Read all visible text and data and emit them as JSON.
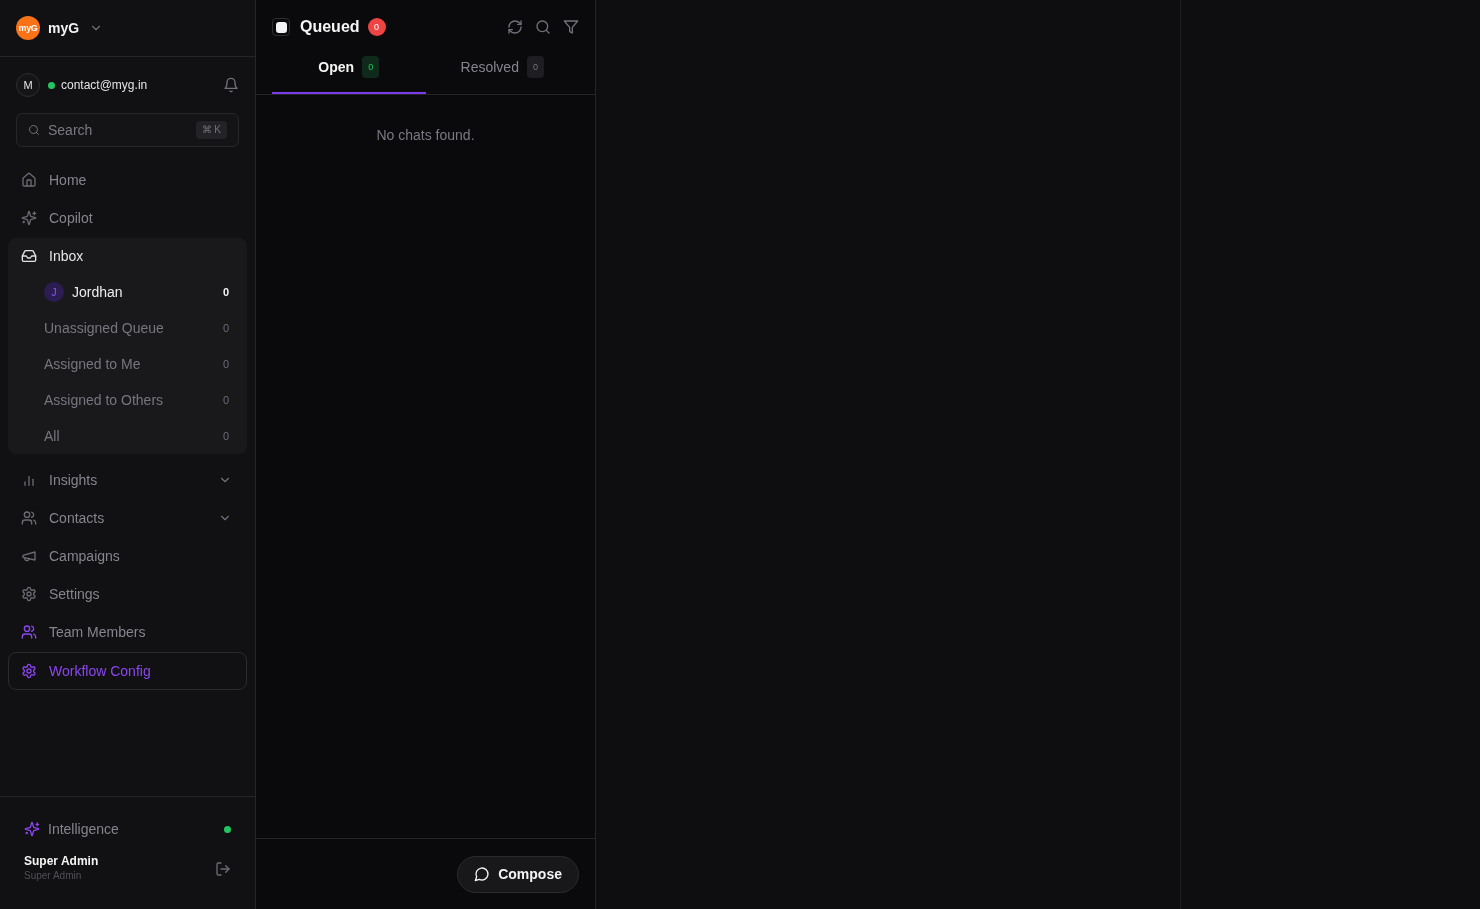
{
  "sidebar": {
    "workspace": {
      "logo": "myG",
      "name": "myG"
    },
    "account": {
      "avatar": "M",
      "email": "contact@myg.in",
      "online": true
    },
    "search": {
      "placeholder": "Search",
      "shortcut": "⌘ K"
    },
    "nav": [
      {
        "label": "Home",
        "kind": "link",
        "selected": false
      },
      {
        "label": "Copilot",
        "kind": "link",
        "selected": false
      },
      {
        "label": "Inbox",
        "kind": "group",
        "selected": false,
        "expanded": true,
        "children": [
          {
            "label": "Jordhan",
            "kind": "agent",
            "avatar": "J",
            "count": "0",
            "selected": true
          },
          {
            "label": "Unassigned Queue",
            "kind": "queue",
            "count": "0",
            "selected": false
          },
          {
            "label": "Assigned to Me",
            "kind": "queue",
            "count": "0",
            "selected": false
          },
          {
            "label": "Assigned to Others",
            "kind": "queue",
            "count": "0",
            "selected": false
          },
          {
            "label": "All",
            "kind": "queue",
            "count": "0",
            "selected": false
          }
        ]
      },
      {
        "label": "Insights",
        "kind": "menu",
        "selected": false,
        "expanded": false
      },
      {
        "label": "Contacts",
        "kind": "menu",
        "selected": false,
        "expanded": false
      },
      {
        "label": "Campaigns",
        "kind": "link",
        "selected": false
      },
      {
        "label": "Settings",
        "kind": "link",
        "selected": false
      },
      {
        "label": "Team Members",
        "kind": "link",
        "selected": false
      },
      {
        "label": "Workflow Config",
        "kind": "link",
        "selected": true
      }
    ],
    "intelligence": {
      "label": "Intelligence",
      "online": true
    },
    "user": {
      "name": "Super Admin",
      "role": "Super Admin"
    }
  },
  "chat_list": {
    "title": "Queued",
    "count": "0",
    "tabs": [
      {
        "label": "Open",
        "count": "0",
        "selected": true
      },
      {
        "label": "Resolved",
        "count": "0",
        "selected": false
      }
    ],
    "empty_message": "No chats found.",
    "compose_button": "Compose"
  }
}
